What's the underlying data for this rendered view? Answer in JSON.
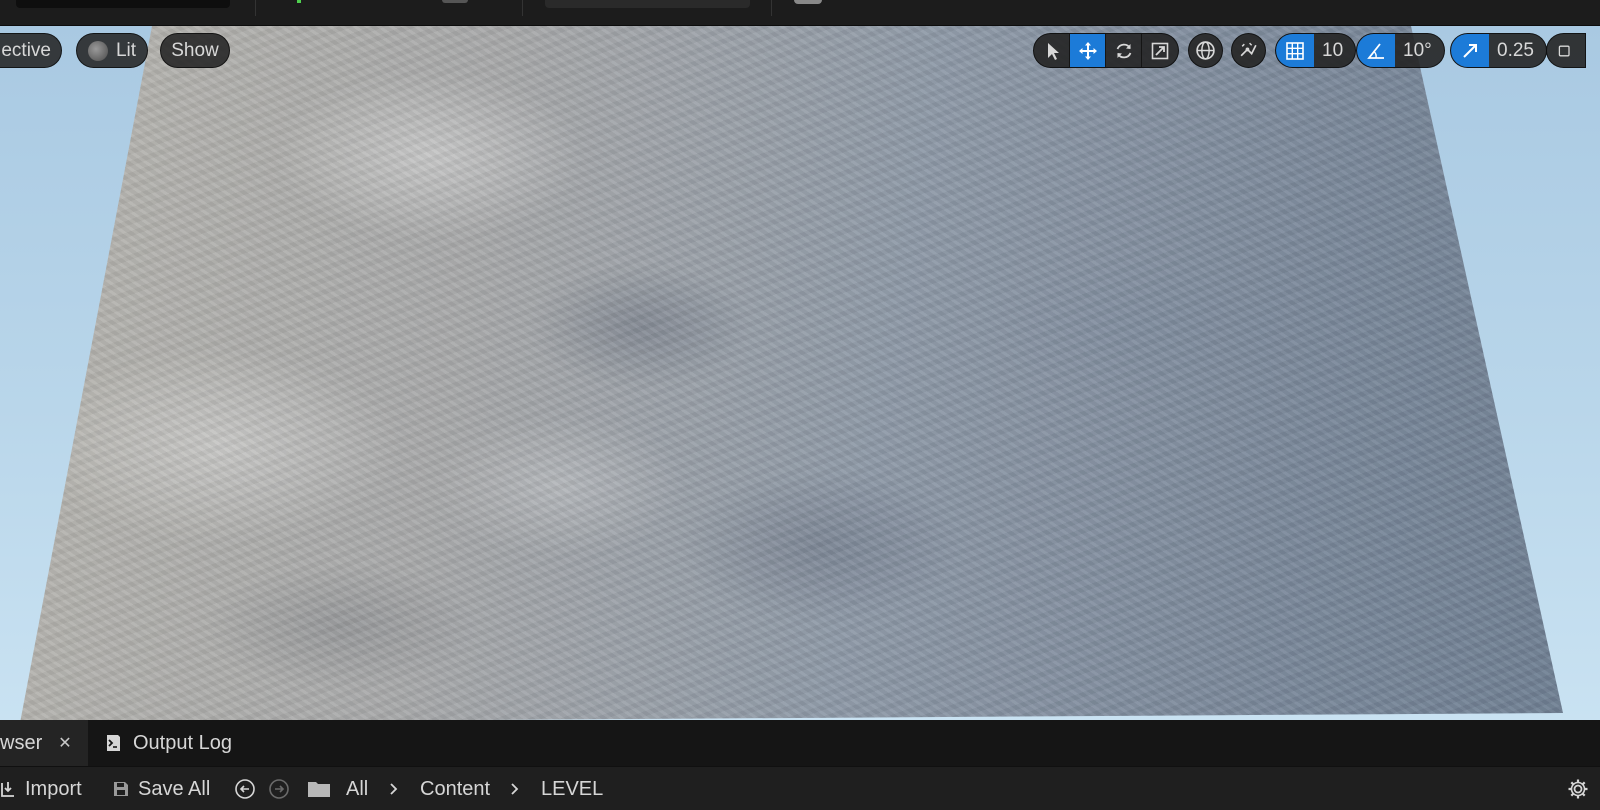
{
  "viewport": {
    "perspective_label": "ective",
    "lit_label": "Lit",
    "show_label": "Show",
    "grid_snap_value": "10",
    "rotation_snap_value": "10°",
    "scale_snap_value": "0.25"
  },
  "bottom_panel": {
    "tabs": [
      {
        "label": "wser",
        "close": "✕"
      },
      {
        "label": "Output Log"
      }
    ],
    "toolbar": {
      "import_label": "Import",
      "save_all_label": "Save All"
    },
    "breadcrumb": [
      "All",
      "Content",
      "LEVEL"
    ]
  },
  "colors": {
    "accent": "#1c7bd8",
    "sky": "#b9d6ea",
    "panel": "#1f1f1f"
  }
}
